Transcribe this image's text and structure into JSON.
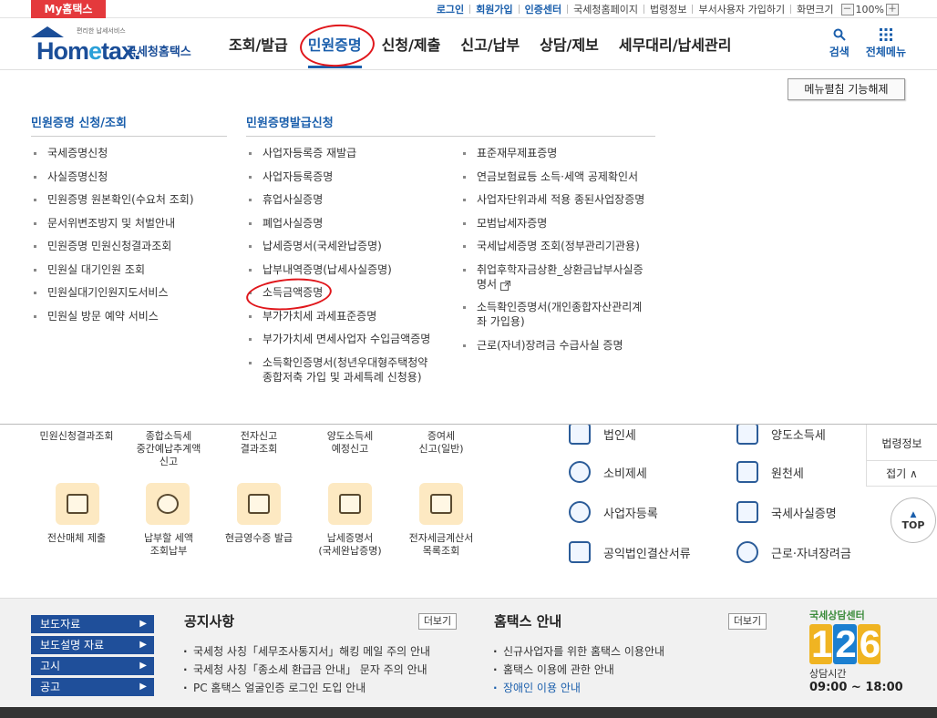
{
  "topbar": {
    "myhome": "My홈택스",
    "util_links": [
      {
        "label": "로그인",
        "hl": true
      },
      {
        "label": "회원가입",
        "hl": true
      },
      {
        "label": "인증센터",
        "hl": true
      },
      {
        "label": "국세청홈페이지",
        "hl": false
      },
      {
        "label": "법령정보",
        "hl": false
      },
      {
        "label": "부서사용자 가입하기",
        "hl": false
      },
      {
        "label": "화면크기",
        "hl": false
      }
    ],
    "zoom_minus": "－",
    "zoom_value": "100%",
    "zoom_plus": "＋"
  },
  "header": {
    "logo_tiny": "편리한 납세서비스",
    "logo_home": "Hom",
    "logo_e": "e",
    "logo_tax": "tax.",
    "logo_sub": "국세청홈택스",
    "nav": [
      "조회/발급",
      "민원증명",
      "신청/제출",
      "신고/납부",
      "상담/제보",
      "세무대리/납세관리"
    ],
    "active_nav": "민원증명",
    "search_label": "검색",
    "allmenu_label": "전체메뉴"
  },
  "panel": {
    "collapse_button": "메뉴펼침 기능해제",
    "col1_title": "민원증명 신청/조회",
    "col1_items": [
      "국세증명신청",
      "사실증명신청",
      "민원증명 원본확인(수요처 조회)",
      "문서위변조방지 및 처벌안내",
      "민원증명 민원신청결과조회",
      "민원실 대기인원 조회",
      "민원실대기인원지도서비스",
      "민원실 방문 예약 서비스"
    ],
    "col2_title": "민원증명발급신청",
    "col2_items": [
      "사업자등록증 재발급",
      "사업자등록증명",
      "휴업사실증명",
      "폐업사실증명",
      "납세증명서(국세완납증명)",
      "납부내역증명(납세사실증명)",
      "소득금액증명",
      "부가가치세 과세표준증명",
      "부가가치세 면세사업자 수입금액증명",
      "소득확인증명서(청년우대형주택청약\n종합저축 가입 및 과세특례 신청용)"
    ],
    "col3_items": [
      "표준재무제표증명",
      "연금보험료등 소득·세액 공제확인서",
      "사업자단위과세 적용 종된사업장증명",
      "모범납세자증명",
      "국세납세증명 조회(정부관리기관용)",
      "취업후학자금상환_상환금납부사실증\n명서",
      "소득확인증명서(개인종합자산관리계\n좌 가입용)",
      "근로(자녀)장려금 수급사실 증명"
    ]
  },
  "quick": {
    "top_row": [
      "민원신청결과조회",
      "종합소득세\n중간예납추계액\n신고",
      "전자신고\n결과조회",
      "양도소득세\n예정신고",
      "증여세\n신고(일반)"
    ],
    "bottom_row": [
      "전산매체 제출",
      "납부할 세액\n조회납부",
      "현금영수증 발급",
      "납세증명서\n(국세완납증명)",
      "전자세금계산서\n목록조회"
    ],
    "side_left": [
      "법인세",
      "소비제세",
      "사업자등록",
      "공익법인결산서류"
    ],
    "side_right": [
      "양도소득세",
      "원천세",
      "국세사실증명",
      "근로·자녀장려금"
    ]
  },
  "floating": {
    "law": "법령정보",
    "fold": "접기 ∧",
    "top": "TOP"
  },
  "notice": {
    "blue_buttons": [
      "보도자료",
      "보도설명 자료",
      "고시",
      "공고"
    ],
    "notice_title": "공지사항",
    "notice_more": "더보기",
    "notice_items": [
      "국세청 사칭「세무조사통지서」해킹 메일 주의 안내",
      "국세청 사칭「종소세 환급금 안내」 문자 주의 안내",
      "PC 홈택스 얼굴인증 로그인 도입 안내"
    ],
    "guide_title": "홈택스 안내",
    "guide_more": "더보기",
    "guide_items": [
      "신규사업자를 위한 홈택스 이용안내",
      "홈택스 이용에 관한 안내",
      "장애인 이용 안내"
    ],
    "call_label": "국세상담센터",
    "call_digits": [
      "1",
      "2",
      "6"
    ],
    "call_hours_label": "상담시간",
    "call_hours": "09:00 ~ 18:00"
  }
}
